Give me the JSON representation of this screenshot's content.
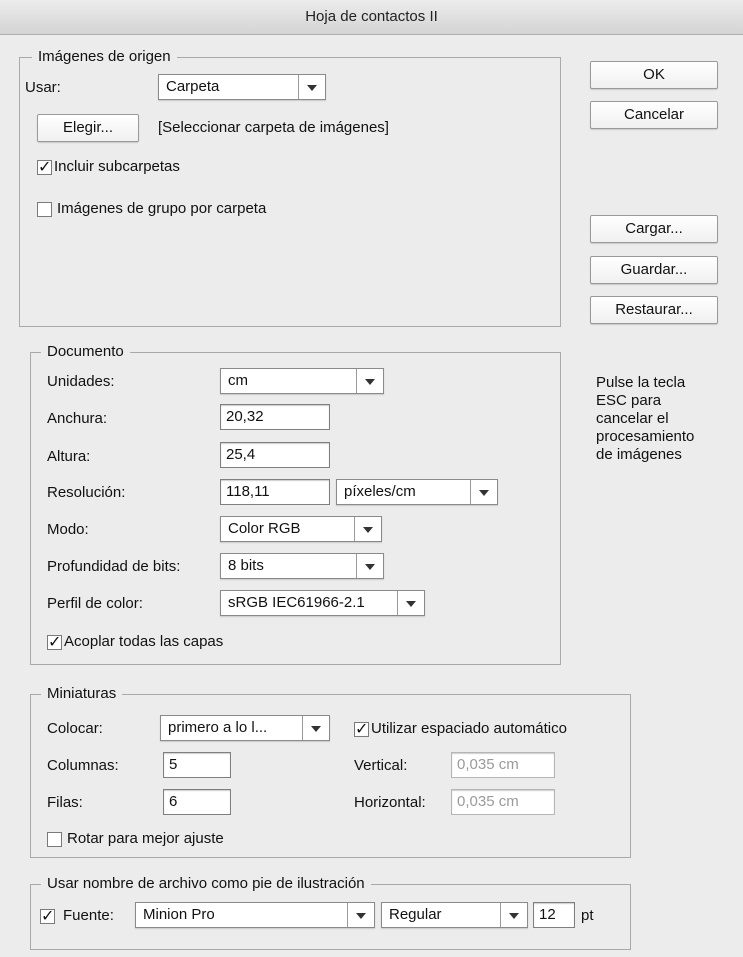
{
  "window": {
    "title": "Hoja de contactos II"
  },
  "buttons": {
    "ok": "OK",
    "cancel": "Cancelar",
    "load": "Cargar...",
    "save": "Guardar...",
    "reset": "Restaurar..."
  },
  "hint": [
    "Pulse la tecla",
    "ESC para",
    "cancelar el",
    "procesamiento",
    "de imágenes"
  ],
  "source": {
    "legend": "Imágenes de origen",
    "use_label": "Usar:",
    "use_value": "Carpeta",
    "choose_button": "Elegir...",
    "choose_text": "[Seleccionar carpeta de imágenes]",
    "include_subfolders": {
      "label": "Incluir subcarpetas",
      "checked": true
    },
    "group_by_folder": {
      "label": "Imágenes de grupo por carpeta",
      "checked": false
    }
  },
  "document": {
    "legend": "Documento",
    "units_label": "Unidades:",
    "units_value": "cm",
    "width_label": "Anchura:",
    "width_value": "20,32",
    "height_label": "Altura:",
    "height_value": "25,4",
    "resolution_label": "Resolución:",
    "resolution_value": "118,11",
    "resolution_unit": "píxeles/cm",
    "mode_label": "Modo:",
    "mode_value": "Color RGB",
    "bit_depth_label": "Profundidad de bits:",
    "bit_depth_value": "8 bits",
    "color_profile_label": "Perfil de color:",
    "color_profile_value": "sRGB IEC61966-2.1",
    "flatten": {
      "label": "Acoplar todas las capas",
      "checked": true
    }
  },
  "thumbnails": {
    "legend": "Miniaturas",
    "place_label": "Colocar:",
    "place_value": "primero a lo l...",
    "auto_spacing": {
      "label": "Utilizar espaciado automático",
      "checked": true
    },
    "columns_label": "Columnas:",
    "columns_value": "5",
    "rows_label": "Filas:",
    "rows_value": "6",
    "vertical_label": "Vertical:",
    "vertical_value": "0,035 cm",
    "horizontal_label": "Horizontal:",
    "horizontal_value": "0,035 cm",
    "rotate": {
      "label": "Rotar para mejor ajuste",
      "checked": false
    }
  },
  "caption": {
    "legend": "Usar nombre de archivo como pie de ilustración",
    "font_checked": true,
    "font_label": "Fuente:",
    "font_value": "Minion Pro",
    "style_value": "Regular",
    "size_value": "12",
    "size_unit": "pt"
  }
}
